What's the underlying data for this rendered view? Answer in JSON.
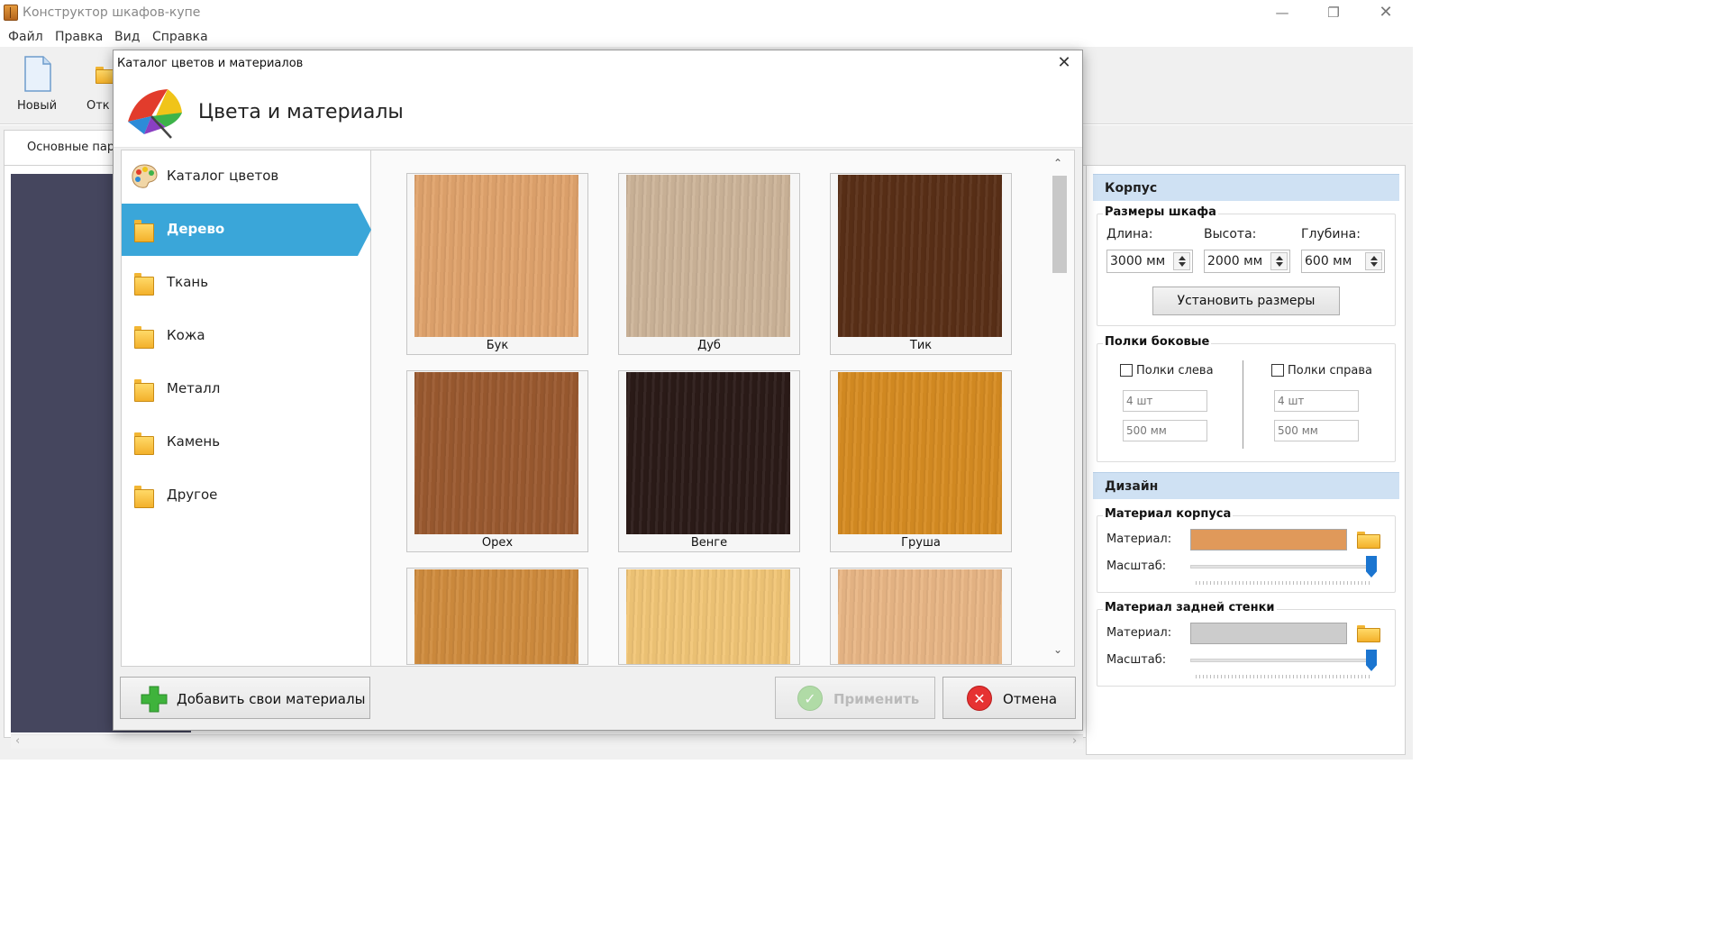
{
  "window": {
    "title": "Конструктор шкафов-купе"
  },
  "menu": [
    "Файл",
    "Правка",
    "Вид",
    "Справка"
  ],
  "toolbar": {
    "new_label": "Новый",
    "open_label": "Отк"
  },
  "main_tab": "Основные пара",
  "props": {
    "korpus_header": "Корпус",
    "sizes": {
      "title": "Размеры шкафа",
      "length_label": "Длина:",
      "length_value": "3000 мм",
      "height_label": "Высота:",
      "height_value": "2000 мм",
      "depth_label": "Глубина:",
      "depth_value": "600 мм",
      "set_button": "Установить размеры"
    },
    "side_shelves": {
      "title": "Полки боковые",
      "left_label": "Полки слева",
      "left_count": "4 шт",
      "left_size": "500 мм",
      "right_label": "Полки справа",
      "right_count": "4 шт",
      "right_size": "500 мм"
    },
    "design_header": "Дизайн",
    "body_material": {
      "title": "Материал корпуса",
      "material_label": "Материал:",
      "scale_label": "Масштаб:",
      "color": "#e0995a",
      "scale": 1.0
    },
    "back_material": {
      "title": "Материал задней стенки",
      "material_label": "Материал:",
      "scale_label": "Масштаб:",
      "color": "#cccccc",
      "scale": 1.0
    }
  },
  "dialog": {
    "title": "Каталог цветов и материалов",
    "heading": "Цвета и материалы",
    "categories": [
      {
        "label": "Каталог цветов",
        "icon": "palette-icon"
      },
      {
        "label": "Дерево",
        "icon": "folder-icon"
      },
      {
        "label": "Ткань",
        "icon": "folder-icon"
      },
      {
        "label": "Кожа",
        "icon": "folder-icon"
      },
      {
        "label": "Металл",
        "icon": "folder-icon"
      },
      {
        "label": "Камень",
        "icon": "folder-icon"
      },
      {
        "label": "Другое",
        "icon": "folder-icon"
      }
    ],
    "active_category": "Дерево",
    "materials": [
      {
        "label": "Бук",
        "color": "#e1a46d"
      },
      {
        "label": "Дуб",
        "color": "#cdb59a"
      },
      {
        "label": "Тик",
        "color": "#5a2f17"
      },
      {
        "label": "Орех",
        "color": "#9b5a30"
      },
      {
        "label": "Венге",
        "color": "#2b1b18"
      },
      {
        "label": "Груша",
        "color": "#d78c22"
      },
      {
        "label": "",
        "color": "#d08c3e"
      },
      {
        "label": "",
        "color": "#f2c677"
      },
      {
        "label": "",
        "color": "#e9b786"
      }
    ],
    "add_button": "Добавить свои материалы",
    "apply_button": "Применить",
    "cancel_button": "Отмена"
  }
}
